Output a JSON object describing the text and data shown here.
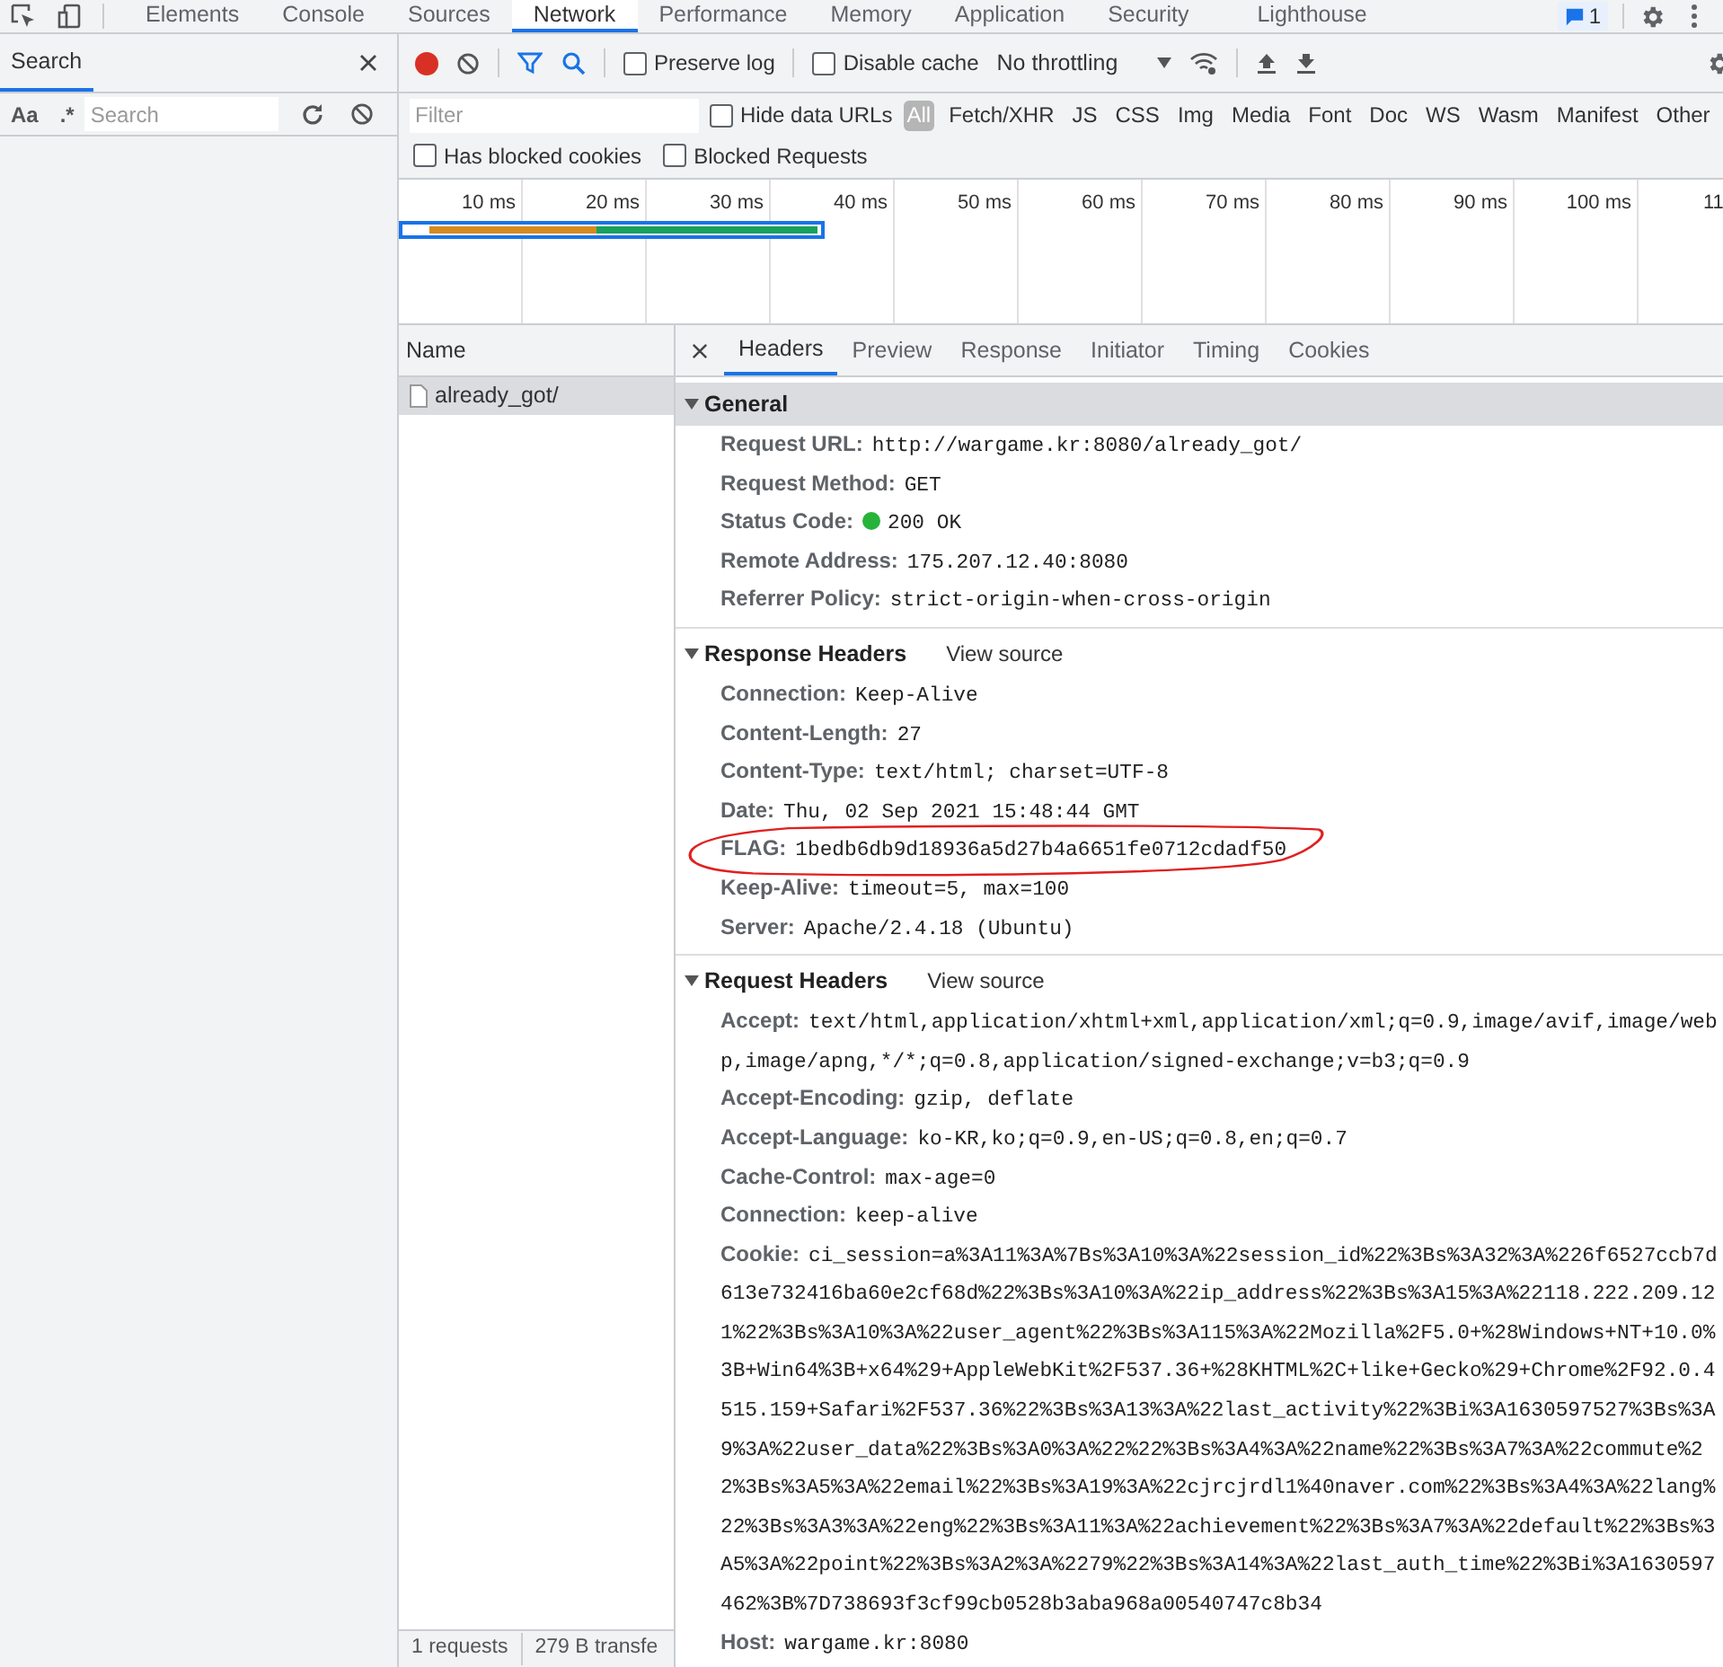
{
  "devtools_tabs": [
    {
      "label": "Elements",
      "selected": false
    },
    {
      "label": "Console",
      "selected": false
    },
    {
      "label": "Sources",
      "selected": false
    },
    {
      "label": "Network",
      "selected": true
    },
    {
      "label": "Performance",
      "selected": false
    },
    {
      "label": "Memory",
      "selected": false
    },
    {
      "label": "Application",
      "selected": false
    },
    {
      "label": "Security",
      "selected": false
    },
    {
      "label": "Lighthouse",
      "selected": false
    }
  ],
  "issues_badge": "1",
  "search_panel": {
    "title": "Search",
    "case_label": "Aa",
    "regex_label": ".*",
    "placeholder": "Search"
  },
  "network_toolbar": {
    "recording": true,
    "preserve_log": {
      "label": "Preserve log",
      "checked": false
    },
    "disable_cache": {
      "label": "Disable cache",
      "checked": false
    },
    "throttling": "No throttling"
  },
  "filter_bar": {
    "placeholder": "Filter",
    "hide_data_urls": {
      "label": "Hide data URLs",
      "checked": false
    },
    "types": [
      {
        "label": "All",
        "selected": true
      },
      {
        "label": "Fetch/XHR",
        "selected": false
      },
      {
        "label": "JS",
        "selected": false
      },
      {
        "label": "CSS",
        "selected": false
      },
      {
        "label": "Img",
        "selected": false
      },
      {
        "label": "Media",
        "selected": false
      },
      {
        "label": "Font",
        "selected": false
      },
      {
        "label": "Doc",
        "selected": false
      },
      {
        "label": "WS",
        "selected": false
      },
      {
        "label": "Wasm",
        "selected": false
      },
      {
        "label": "Manifest",
        "selected": false
      },
      {
        "label": "Other",
        "selected": false
      }
    ],
    "has_blocked_cookies": {
      "label": "Has blocked cookies",
      "checked": false
    },
    "blocked_requests": {
      "label": "Blocked Requests",
      "checked": false
    }
  },
  "timeline": {
    "ticks": [
      "10 ms",
      "20 ms",
      "30 ms",
      "40 ms",
      "50 ms",
      "60 ms",
      "70 ms",
      "80 ms",
      "90 ms",
      "100 ms",
      "11"
    ]
  },
  "requests": {
    "column": "Name",
    "rows": [
      {
        "name": "already_got/",
        "selected": true
      }
    ]
  },
  "detail_tabs": [
    {
      "label": "Headers",
      "selected": true
    },
    {
      "label": "Preview",
      "selected": false
    },
    {
      "label": "Response",
      "selected": false
    },
    {
      "label": "Initiator",
      "selected": false
    },
    {
      "label": "Timing",
      "selected": false
    },
    {
      "label": "Cookies",
      "selected": false
    }
  ],
  "sections": [
    {
      "title": "General",
      "expanded": true,
      "rows": [
        {
          "name": "Request URL:",
          "value": "http://wargame.kr:8080/already_got/"
        },
        {
          "name": "Request Method:",
          "value": "GET"
        },
        {
          "name": "Status Code:",
          "value": "200 OK",
          "color": "#27b33a"
        },
        {
          "name": "Remote Address:",
          "value": "175.207.12.40:8080"
        },
        {
          "name": "Referrer Policy:",
          "value": "strict-origin-when-cross-origin"
        }
      ]
    },
    {
      "title": "Response Headers",
      "link": "View source",
      "expanded": true,
      "rows": [
        {
          "name": "Connection:",
          "value": "Keep-Alive"
        },
        {
          "name": "Content-Length:",
          "value": "27"
        },
        {
          "name": "Content-Type:",
          "value": "text/html; charset=UTF-8"
        },
        {
          "name": "Date:",
          "value": "Thu, 02 Sep 2021 15:48:44 GMT"
        },
        {
          "name": "FLAG:",
          "value": "1bedb6db9d18936a5d27b4a6651fe0712cdadf50",
          "circled": true
        },
        {
          "name": "Keep-Alive:",
          "value": "timeout=5, max=100"
        },
        {
          "name": "Server:",
          "value": "Apache/2.4.18 (Ubuntu)"
        }
      ]
    },
    {
      "title": "Request Headers",
      "link": "View source",
      "expanded": true,
      "rows": [
        {
          "name": "Accept:",
          "value": "text/html,application/xhtml+xml,application/xml;q=0.9,image/avif,image/webp,image/apng,*/*;q=0.8,application/signed-exchange;v=b3;q=0.9"
        },
        {
          "name": "Accept-Encoding:",
          "value": "gzip, deflate"
        },
        {
          "name": "Accept-Language:",
          "value": "ko-KR,ko;q=0.9,en-US;q=0.8,en;q=0.7"
        },
        {
          "name": "Cache-Control:",
          "value": "max-age=0"
        },
        {
          "name": "Connection:",
          "value": "keep-alive"
        },
        {
          "name": "Cookie:",
          "value": "ci_session=a%3A11%3A%7Bs%3A10%3A%22session_id%22%3Bs%3A32%3A%226f6527ccb7d613e732416ba60e2cf68d%22%3Bs%3A10%3A%22ip_address%22%3Bs%3A15%3A%22118.222.209.121%22%3Bs%3A10%3A%22user_agent%22%3Bs%3A115%3A%22Mozilla%2F5.0+%28Windows+NT+10.0%3B+Win64%3B+x64%29+AppleWebKit%2F537.36+%28KHTML%2C+like+Gecko%29+Chrome%2F92.0.4515.159+Safari%2F537.36%22%3Bs%3A13%3A%22last_activity%22%3Bi%3A1630597527%3Bs%3A9%3A%22user_data%22%3Bs%3A0%3A%22%22%3Bs%3A4%3A%22name%22%3Bs%3A7%3A%22commute%22%3Bs%3A5%3A%22email%22%3Bs%3A19%3A%22cjrcjrdl1%40naver.com%22%3Bs%3A4%3A%22lang%22%3Bs%3A3%3A%22eng%22%3Bs%3A11%3A%22achievement%22%3Bs%3A7%3A%22default%22%3Bs%3A5%3A%22point%22%3Bs%3A2%3A%2279%22%3Bs%3A14%3A%22last_auth_time%22%3Bi%3A1630597462%3B%7D738693f3cf99cb0528b3aba968a00540747c8b34"
        },
        {
          "name": "Host:",
          "value": "wargame.kr:8080"
        }
      ]
    }
  ],
  "status_bar": [
    "1 requests",
    "279 B transfe"
  ]
}
